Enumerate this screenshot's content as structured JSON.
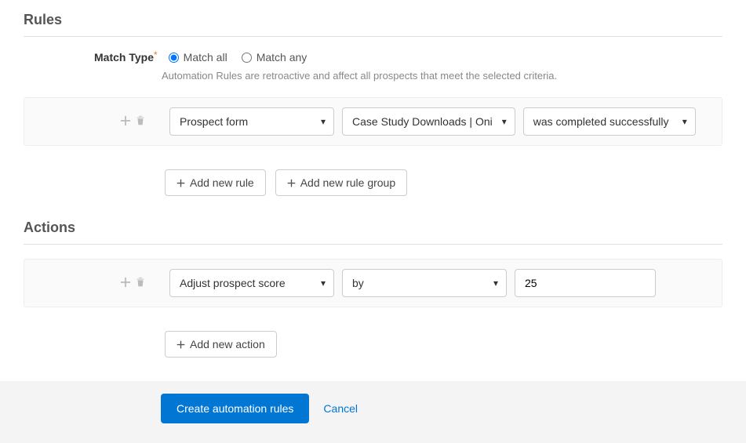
{
  "rules": {
    "title": "Rules",
    "matchTypeLabel": "Match Type",
    "matchAllLabel": "Match all",
    "matchAnyLabel": "Match any",
    "matchTypeSelected": "all",
    "hint": "Automation Rules are retroactive and affect all prospects that meet the selected criteria.",
    "row": {
      "field": "Prospect form",
      "value": "Case Study Downloads | Oni",
      "operator": "was completed successfully"
    },
    "addNewRule": "Add new rule",
    "addNewRuleGroup": "Add new rule group"
  },
  "actions": {
    "title": "Actions",
    "row": {
      "action": "Adjust prospect score",
      "modifier": "by",
      "value": "25"
    },
    "addNewAction": "Add new action"
  },
  "footer": {
    "submit": "Create automation rules",
    "cancel": "Cancel"
  }
}
